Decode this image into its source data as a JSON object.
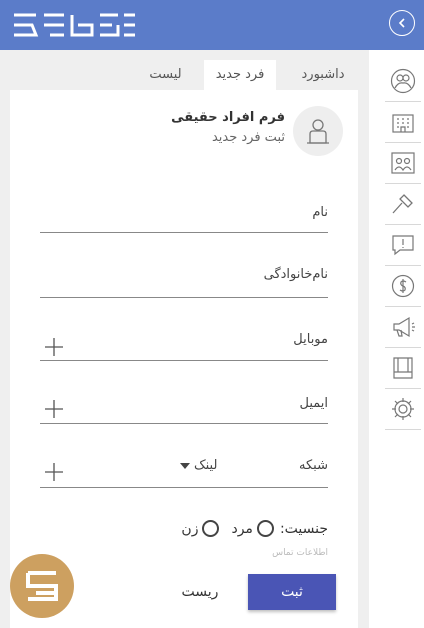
{
  "header": {
    "back_icon": "chevron-left-icon",
    "logo": "brand-logo"
  },
  "tabs": [
    {
      "label": "داشبورد"
    },
    {
      "label": "فرد جدید",
      "active": true
    },
    {
      "label": "لیست"
    }
  ],
  "form": {
    "title": "فرم افراد حقیقی",
    "subtitle": "ثبت فرد جدید",
    "fields": {
      "name": "نام",
      "family": "نام‌خانوادگی",
      "mobile": "موبایل",
      "email": "ایمیل",
      "network": "شبکه",
      "network_value": "لینک"
    },
    "gender": {
      "label": "جنسیت:",
      "male": "مرد",
      "female": "زن"
    },
    "contact_hint": "اطلاعات تماس",
    "submit_label": "ثبت",
    "reset_label": "ریست"
  },
  "sidebar": {
    "items": [
      {
        "icon": "users-icon"
      },
      {
        "icon": "building-icon"
      },
      {
        "icon": "presentation-icon"
      },
      {
        "icon": "hammer-icon"
      },
      {
        "icon": "alert-message-icon"
      },
      {
        "icon": "dollar-icon"
      },
      {
        "icon": "megaphone-icon"
      },
      {
        "icon": "box-icon"
      },
      {
        "icon": "gear-icon"
      }
    ]
  },
  "colors": {
    "header": "#5b7cc9",
    "submit": "#4a55b5",
    "fab": "#cda060"
  }
}
